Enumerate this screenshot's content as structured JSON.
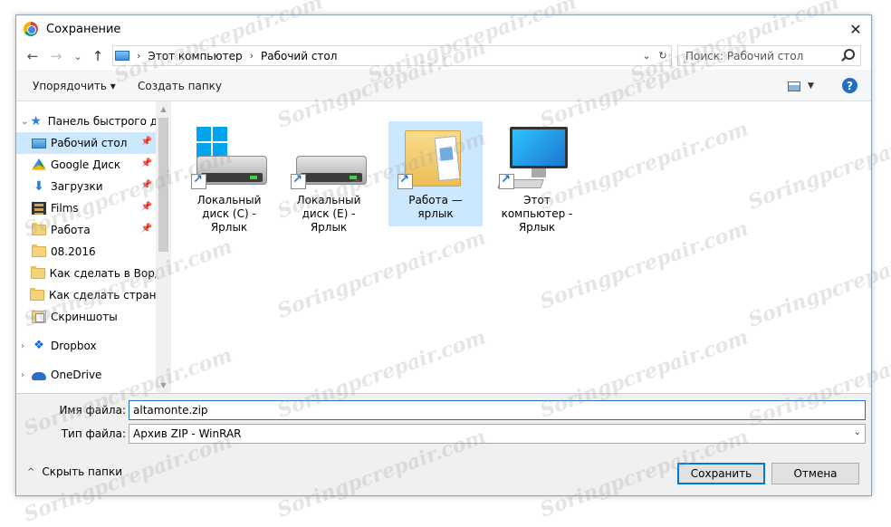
{
  "window": {
    "title": "Сохранение",
    "close": "✕"
  },
  "nav": {
    "back": "←",
    "forward": "→",
    "recent": "⌄",
    "up": "↑",
    "breadcrumb": [
      "Этот компьютер",
      "Рабочий стол"
    ],
    "breadcrumb_sep": "›",
    "dropdown": "⌄",
    "refresh": "↻",
    "search_placeholder": "Поиск: Рабочий стол"
  },
  "toolbar": {
    "organize": "Упорядочить ▾",
    "new_folder": "Создать папку",
    "help": "?",
    "view_dropdown": "▼"
  },
  "sidebar": {
    "items": [
      {
        "label": "Панель быстрого доступа",
        "icon": "star-icon",
        "chevron": "⌄"
      },
      {
        "label": "Рабочий стол",
        "icon": "desktop-icon",
        "pinned": true,
        "selected": true
      },
      {
        "label": "Google Диск",
        "icon": "google-drive-icon",
        "pinned": true
      },
      {
        "label": "Загрузки",
        "icon": "download-icon",
        "pinned": true
      },
      {
        "label": "Films",
        "icon": "film-icon",
        "pinned": true
      },
      {
        "label": "Работа",
        "icon": "folder-icon",
        "pinned": true
      },
      {
        "label": "08.2016",
        "icon": "folder-icon"
      },
      {
        "label": "Как сделать в Ворде",
        "icon": "folder-icon"
      },
      {
        "label": "Как сделать страницу",
        "icon": "folder-icon"
      },
      {
        "label": "Скриншоты",
        "icon": "screenshots-folder-icon"
      },
      {
        "label": "Dropbox",
        "icon": "dropbox-icon",
        "chevron": "›"
      },
      {
        "label": "OneDrive",
        "icon": "onedrive-icon",
        "chevron": "›"
      }
    ],
    "pin_glyph": "📌"
  },
  "files": [
    {
      "name": "Локальный диск (C) - Ярлык",
      "icon": "drive-c-shortcut-icon"
    },
    {
      "name": "Локальный диск (E) - Ярлык",
      "icon": "drive-e-shortcut-icon"
    },
    {
      "name": "Работа — ярлык",
      "icon": "folder-shortcut-icon",
      "selected": true
    },
    {
      "name": "Этот компьютер - Ярлык",
      "icon": "computer-shortcut-icon"
    }
  ],
  "form": {
    "filename_label": "Имя файла:",
    "filename_value": "altamonte.zip",
    "filetype_label": "Тип файла:",
    "filetype_value": "Архив ZIP - WinRAR",
    "filetype_caret": "⌄"
  },
  "footer": {
    "hide_folders": "Скрыть папки",
    "save": "Сохранить",
    "cancel": "Отмена",
    "up_glyph": "^"
  },
  "watermark": "Soringpcrepair.com",
  "colors": {
    "selection": "#cce8ff",
    "accent": "#0078d7",
    "help": "#1f6fc5"
  }
}
